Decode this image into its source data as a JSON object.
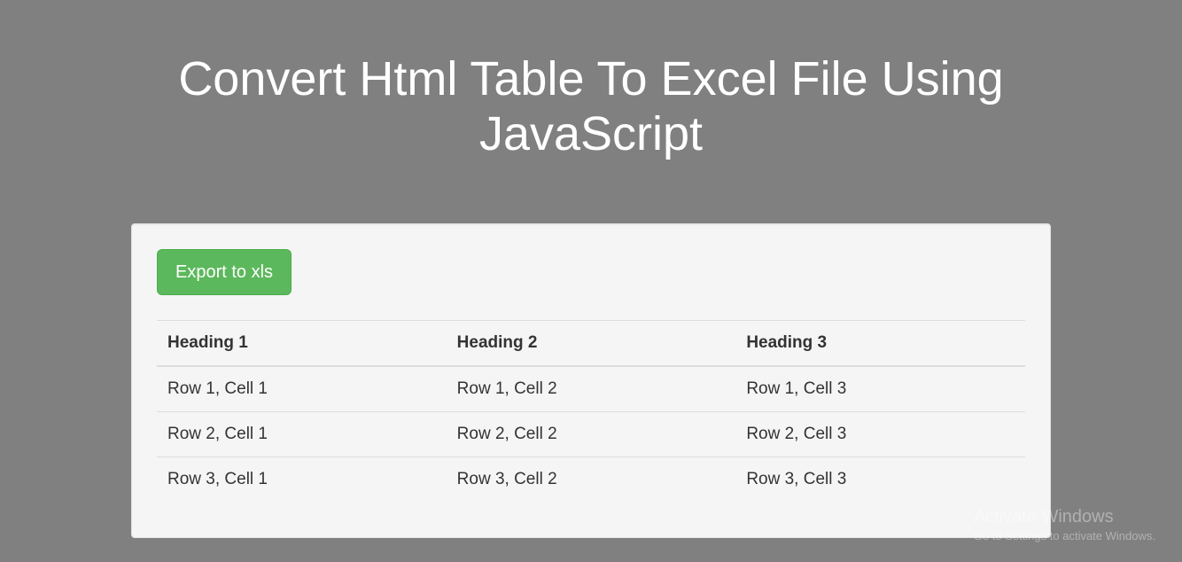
{
  "title": "Convert Html Table To Excel File Using JavaScript",
  "button": {
    "export_label": "Export to xls"
  },
  "table": {
    "headers": [
      "Heading 1",
      "Heading 2",
      "Heading 3"
    ],
    "rows": [
      [
        "Row 1, Cell 1",
        "Row 1, Cell 2",
        "Row 1, Cell 3"
      ],
      [
        "Row 2, Cell 1",
        "Row 2, Cell 2",
        "Row 2, Cell 3"
      ],
      [
        "Row 3, Cell 1",
        "Row 3, Cell 2",
        "Row 3, Cell 3"
      ]
    ]
  },
  "watermark": {
    "title": "Activate Windows",
    "subtitle": "Go to Settings to activate Windows."
  }
}
